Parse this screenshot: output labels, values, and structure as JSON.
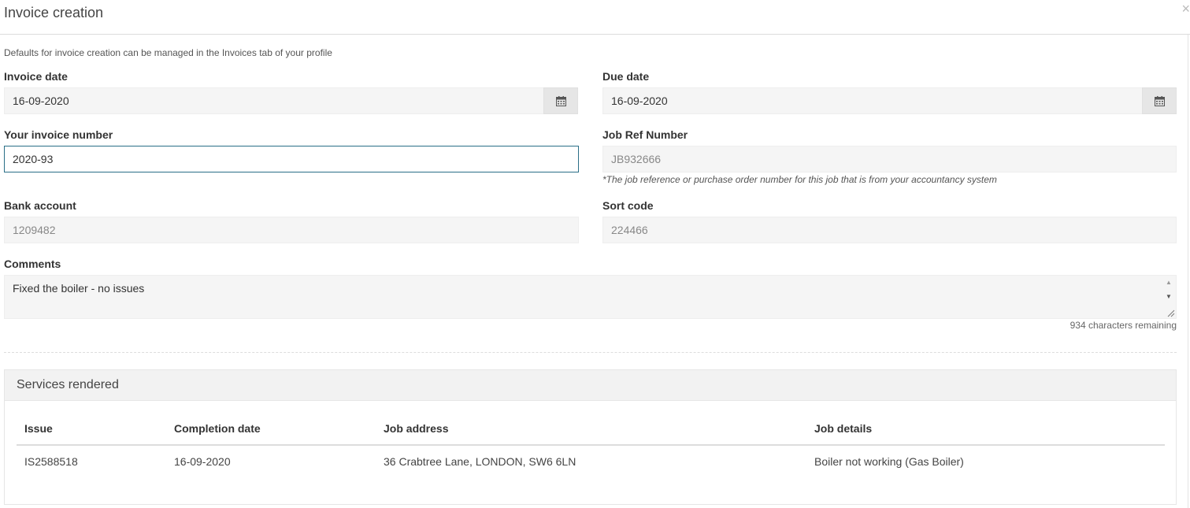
{
  "modal": {
    "title": "Invoice creation",
    "close_symbol": "×"
  },
  "hint": "Defaults for invoice creation can be managed in the Invoices tab of your profile",
  "invoice_date": {
    "label": "Invoice date",
    "value": "16-09-2020"
  },
  "due_date": {
    "label": "Due date",
    "value": "16-09-2020"
  },
  "invoice_number": {
    "label": "Your invoice number",
    "value": "2020-93"
  },
  "job_ref": {
    "label": "Job Ref Number",
    "value": "JB932666",
    "help": "*The job reference or purchase order number for this job that is from your accountancy system"
  },
  "bank_account": {
    "label": "Bank account",
    "value": "1209482"
  },
  "sort_code": {
    "label": "Sort code",
    "value": "224466"
  },
  "comments": {
    "label": "Comments",
    "value": "Fixed the boiler - no issues",
    "remaining": "934 characters remaining"
  },
  "services": {
    "title": "Services rendered",
    "headers": [
      "Issue",
      "Completion date",
      "Job address",
      "Job details"
    ],
    "rows": [
      [
        "IS2588518",
        "16-09-2020",
        "36 Crabtree Lane, LONDON, SW6 6LN",
        "Boiler not working (Gas Boiler)"
      ]
    ]
  },
  "icons": {
    "calendar": "calendar-icon",
    "close": "close-icon"
  },
  "colors": {
    "active_border": "#2a6f87",
    "field_bg": "#f5f5f5",
    "panel_head_bg": "#f2f2f2"
  }
}
